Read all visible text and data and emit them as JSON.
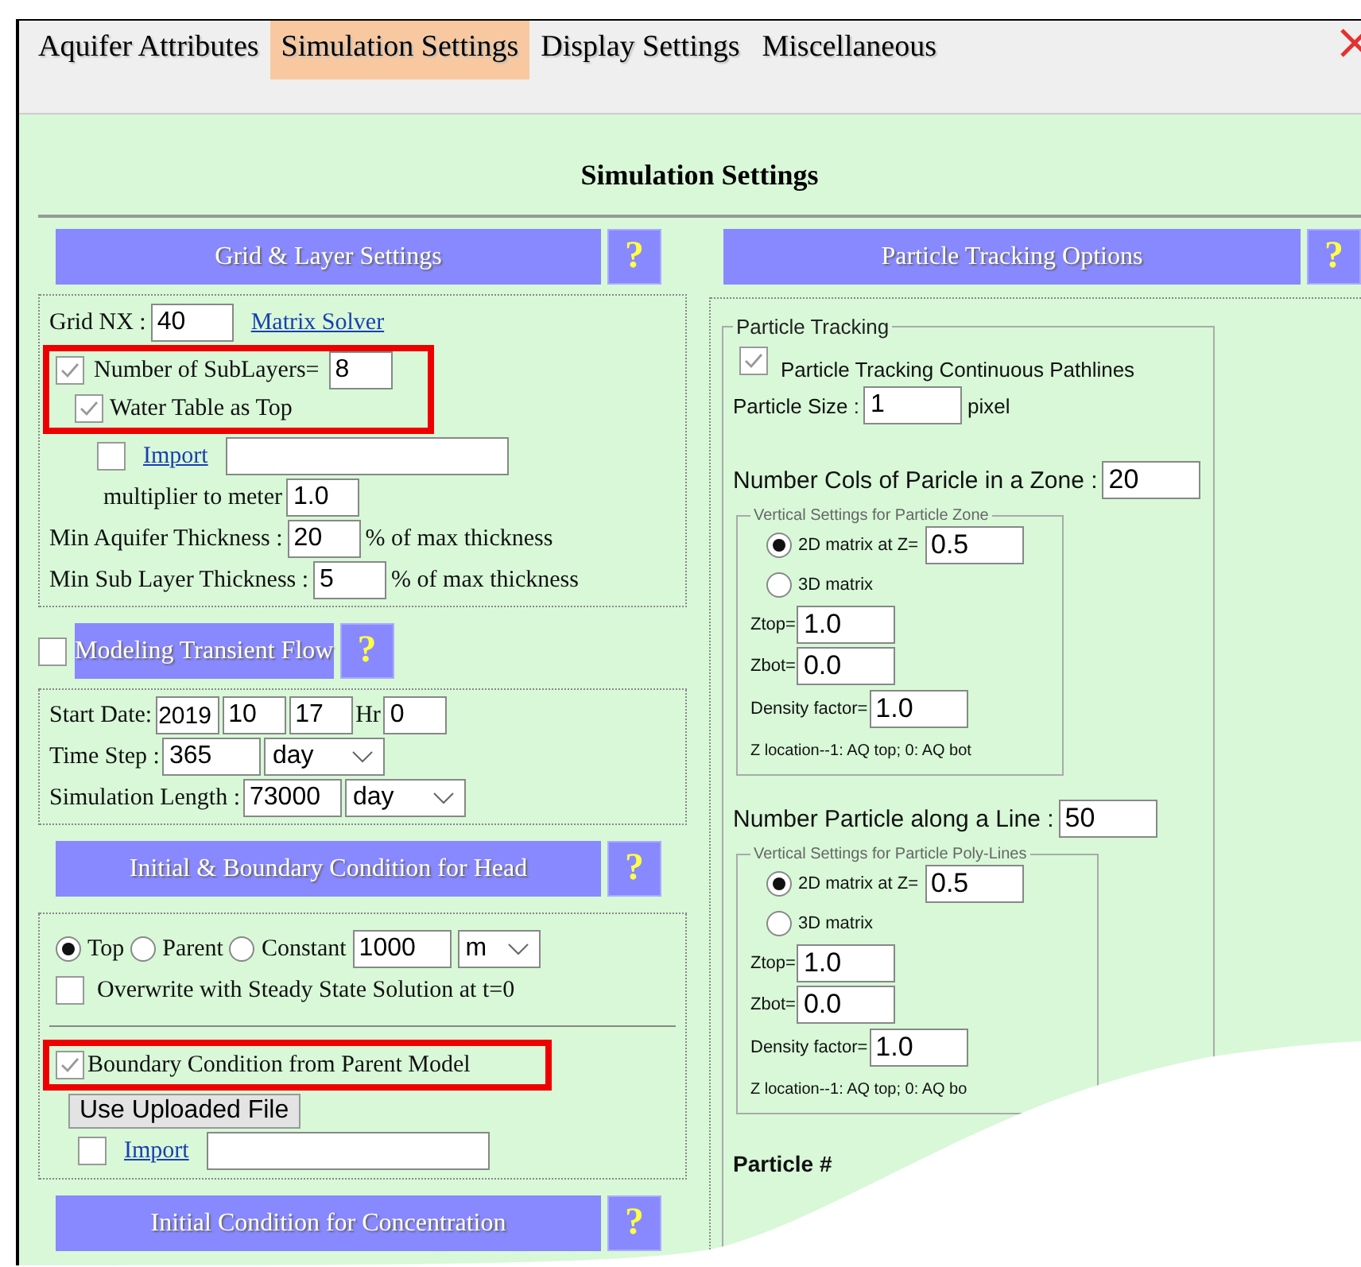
{
  "tabs": [
    {
      "label": "Aquifer Attributes",
      "selected": false
    },
    {
      "label": "Simulation Settings",
      "selected": true
    },
    {
      "label": "Display Settings",
      "selected": false
    },
    {
      "label": "Miscellaneous",
      "selected": false
    }
  ],
  "title": "Simulation Settings",
  "grid_layer": {
    "header": "Grid & Layer Settings",
    "help": "?",
    "grid_nx": {
      "label": "Grid NX :",
      "value": "40"
    },
    "matrix_solver": "Matrix Solver",
    "highlighted": true,
    "sublayers": {
      "label": "Number of SubLayers=",
      "checked": true,
      "value": "8"
    },
    "water_table": {
      "label": "Water Table as Top",
      "checked": true
    },
    "import": {
      "checked": false,
      "link": "Import"
    },
    "multiplier": {
      "label": "multiplier to meter",
      "value": "1.0"
    },
    "min_aquifer": {
      "label": "Min Aquifer Thickness :",
      "value": "20",
      "unit": "% of max thickness"
    },
    "min_sublayer": {
      "label": "Min Sub Layer Thickness :",
      "value": "5",
      "unit": "% of max thickness"
    }
  },
  "transient": {
    "checked": false,
    "header": "Modeling Transient Flow",
    "help": "?",
    "start_date": {
      "label": "Start Date:",
      "year": "2019",
      "month": "10",
      "day": "17"
    },
    "hour": {
      "label": "Hr",
      "value": "0"
    },
    "time_step": {
      "label": "Time Step :",
      "value": "365",
      "unit": "day"
    },
    "sim_length": {
      "label": "Simulation Length :",
      "value": "73000",
      "unit": "day"
    }
  },
  "head": {
    "header": "Initial & Boundary Condition for Head",
    "help": "?",
    "options": [
      {
        "label": "Top",
        "selected": true
      },
      {
        "label": "Parent",
        "selected": false
      },
      {
        "label": "Constant",
        "selected": false
      }
    ],
    "constant_value": "1000",
    "constant_unit": "m",
    "overwrite": {
      "label": "Overwrite with Steady State Solution at t=0",
      "checked": false
    },
    "boundary": {
      "label": "Boundary Condition from Parent Model",
      "checked": true,
      "highlighted": true
    },
    "upload_button": "Use Uploaded File",
    "import": {
      "checked": false,
      "link": "Import"
    }
  },
  "concentration": {
    "header": "Initial Condition for Concentration",
    "help": "?"
  },
  "particle": {
    "header": "Particle Tracking Options",
    "help": "?",
    "group_title": "Particle Tracking",
    "continuous": {
      "label": "Particle Tracking Continuous Pathlines",
      "checked": true
    },
    "size": {
      "label": "Particle Size :",
      "value": "1",
      "unit": "pixel"
    },
    "zones": [
      {
        "count_label": "Number Cols of Paricle in a Zone :",
        "count": "20",
        "legend": "Vertical Settings for Particle Zone",
        "modes": [
          {
            "label": "2D matrix at Z=",
            "selected": true
          },
          {
            "label": "3D matrix",
            "selected": false
          }
        ],
        "z_value": "0.5",
        "ztop": {
          "label": "Ztop=",
          "value": "1.0"
        },
        "zbot": {
          "label": "Zbot=",
          "value": "0.0"
        },
        "density": {
          "label": "Density factor=",
          "value": "1.0"
        },
        "note": "Z location--1: AQ top; 0: AQ bot"
      },
      {
        "count_label": "Number Particle along a Line :",
        "count": "50",
        "legend": "Vertical Settings for Particle Poly-Lines",
        "modes": [
          {
            "label": "2D matrix at Z=",
            "selected": true
          },
          {
            "label": "3D matrix",
            "selected": false
          }
        ],
        "z_value": "0.5",
        "ztop": {
          "label": "Ztop=",
          "value": "1.0"
        },
        "zbot": {
          "label": "Zbot=",
          "value": "0.0"
        },
        "density": {
          "label": "Density factor=",
          "value": "1.0"
        },
        "note": "Z location--1: AQ top; 0: AQ bo"
      }
    ],
    "next_label": "Particle #"
  }
}
